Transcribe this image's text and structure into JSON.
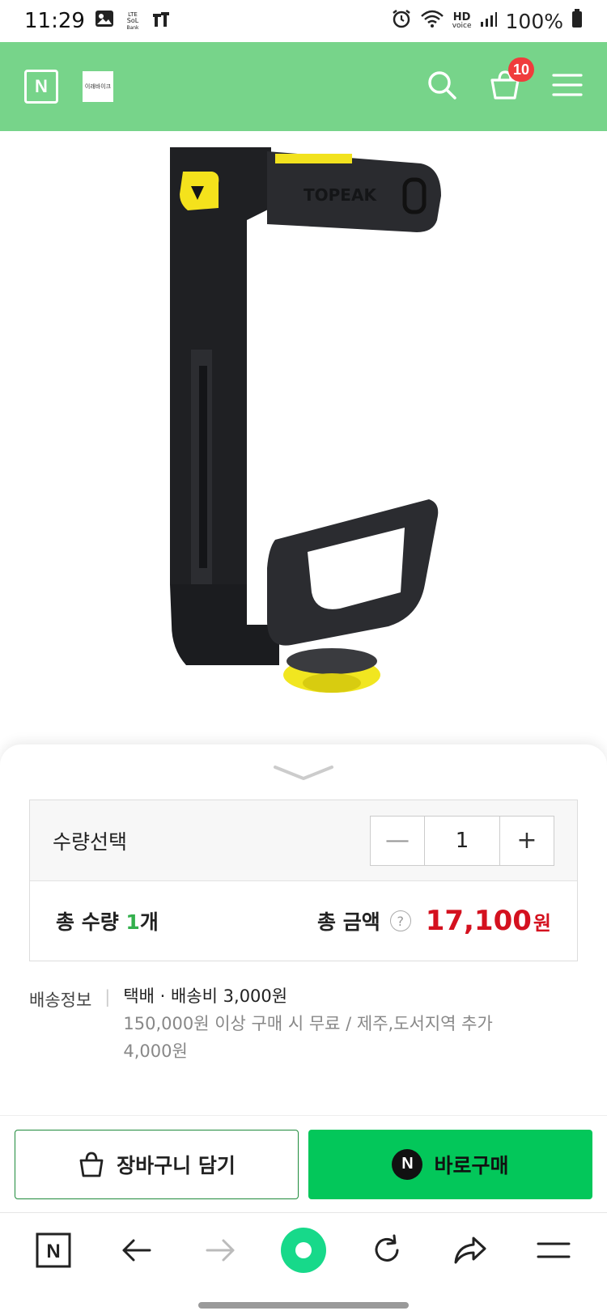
{
  "status_bar": {
    "time": "11:29",
    "carrier_small": "LTE\nSoL\nBank",
    "battery": "100%",
    "hd_label": "HD",
    "voice_label": "voice"
  },
  "header": {
    "n_logo": "N",
    "store_logo_text": "이래바이크",
    "cart_count": "10",
    "brand_color": "#77d48a"
  },
  "product": {
    "brand_mark": "TOPEAK"
  },
  "sheet": {
    "qty_label": "수량선택",
    "qty_minus": "—",
    "qty_value": "1",
    "qty_plus": "+",
    "total_qty_label": "총 수량 ",
    "total_qty_count": "1",
    "total_qty_unit": "개",
    "total_price_label": "총 금액",
    "help_symbol": "?",
    "price": "17,100",
    "price_unit": "원",
    "price_color": "#d4111f"
  },
  "shipping": {
    "label": "배송정보",
    "separator": "|",
    "line1": "택배 · 배송비 3,000원",
    "line2": "150,000원 이상 구매 시 무료 / 제주,도서지역 추가",
    "line3": "4,000원"
  },
  "actions": {
    "add_to_cart": "장바구니 담기",
    "buy_now": "바로구매",
    "npay_symbol": "N",
    "buy_color": "#03c75a"
  },
  "browser_nav": {
    "home_label": "N"
  }
}
